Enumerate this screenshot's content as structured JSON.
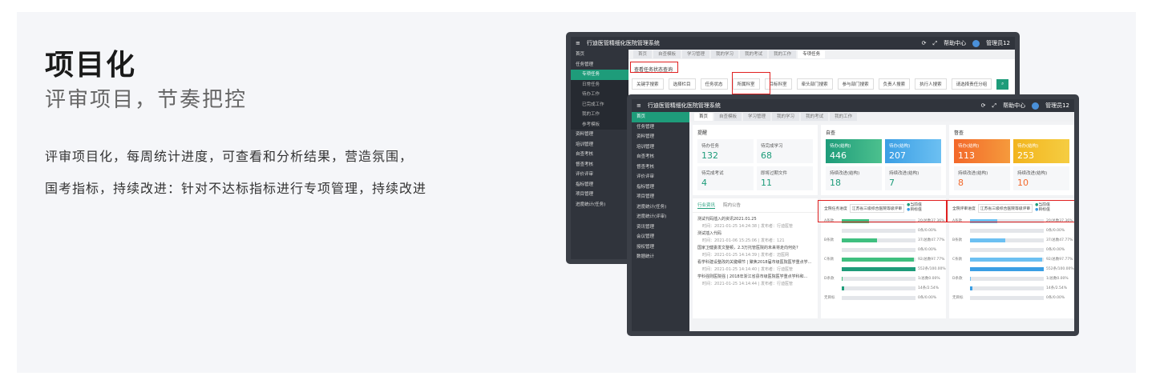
{
  "heading": {
    "title": "项目化",
    "subtitle": "评审项目，节奏把控",
    "line1": "评审项目化，每周统计进度，可查看和分析结果，营造氛围，",
    "line2": "国考指标，持续改进：针对不达标指标进行专项管理，持续改进"
  },
  "app": {
    "name": "行迪医管精细化医院管理系统",
    "help": "帮助中心",
    "user": "管理员12"
  },
  "back": {
    "tabs": [
      "首页",
      "自查模板",
      "学习管理",
      "我的学习",
      "我的考试",
      "我的工作",
      "专项任务"
    ],
    "side": [
      {
        "l": "首页",
        "t": "m"
      },
      {
        "l": "任务管理",
        "t": "m"
      },
      {
        "l": "专项任务",
        "t": "sa"
      },
      {
        "l": "日常任务",
        "t": "s"
      },
      {
        "l": "待办工作",
        "t": "s"
      },
      {
        "l": "已完成工作",
        "t": "s"
      },
      {
        "l": "我的工作",
        "t": "s"
      },
      {
        "l": "参考模板",
        "t": "s"
      },
      {
        "l": "资料管理",
        "t": "m"
      },
      {
        "l": "培训管理",
        "t": "m"
      },
      {
        "l": "自查考核",
        "t": "m"
      },
      {
        "l": "督查考核",
        "t": "m"
      },
      {
        "l": "评价评审",
        "t": "m"
      },
      {
        "l": "指标管理",
        "t": "m"
      },
      {
        "l": "项目管理",
        "t": "m"
      },
      {
        "l": "进度统计(任务)",
        "t": "m"
      }
    ],
    "btn": "查看任务状态查询",
    "filters": [
      "关键字搜索",
      "选择栏目",
      "任务状态",
      "所属科室",
      "目标科室",
      "牵头部门搜索",
      "参与部门搜索",
      "负责人搜索",
      "执行人搜索",
      "请选择责任分组"
    ]
  },
  "front": {
    "tabs": [
      "首页",
      "自查模板",
      "学习管理",
      "我的学习",
      "我的考试",
      "我的工作"
    ],
    "side": [
      "首页",
      "任务管理",
      "资料管理",
      "培训管理",
      "自查考核",
      "督查考核",
      "评价评审",
      "指标管理",
      "项目管理",
      "进度统计(任务)",
      "进度统计(评审)",
      "资讯管理",
      "会议管理",
      "授权管理",
      "数据统计"
    ],
    "remind": {
      "title": "提醒",
      "tiles": [
        {
          "l": "待办任务",
          "v": "132"
        },
        {
          "l": "待完成学习",
          "v": "68"
        },
        {
          "l": "待完成考试",
          "v": "4"
        },
        {
          "l": "即将过期文件",
          "v": "11"
        }
      ]
    },
    "self": {
      "title": "自查",
      "tiles": [
        {
          "l": "待办(结构)",
          "v": "446"
        },
        {
          "l": "待办(结构)",
          "v": "207"
        },
        {
          "l": "持续改进(结构)",
          "v": "18"
        },
        {
          "l": "持续改进(结构)",
          "v": "7"
        }
      ]
    },
    "sup": {
      "title": "督查",
      "tiles": [
        {
          "l": "待办(结构)",
          "v": "113"
        },
        {
          "l": "待办(结构)",
          "v": "253"
        },
        {
          "l": "持续改进(结构)",
          "v": "8"
        },
        {
          "l": "持续改进(结构)",
          "v": "10"
        }
      ]
    },
    "newsTabs": [
      "行业资讯",
      "院内公告"
    ],
    "news": [
      {
        "t": "测试代码插入的资讯2021.01.25",
        "m": "时间：2021-01-25 14:24:38 | 发布者：行迪医管"
      },
      {
        "t": "测试插入代码",
        "m": "时间：2021-01-06 15:25:06 | 发布者：121"
      },
      {
        "t": "国家卫健委发文整顿，2.3万托管医院的未来将走向何处?",
        "m": "时间：2021-01-25 14:14:39 | 发布者：迈医网"
      },
      {
        "t": "看学科建设整改的关键细节 | 聚焦2018届市级医院医学重点学...",
        "m": "时间：2021-01-25 14:14:40 | 发布者：行迪医管"
      },
      {
        "t": "学科强则医院强 | 2018年浙江省县市级医院医学重点学科和...",
        "m": "时间：2021-01-25 14:14:44 | 发布者：行迪医管"
      }
    ],
    "prog1": {
      "label": "全院任务进度",
      "sel": "江苏省三级综合医院等级评审",
      "leg": [
        "当前值",
        "目标值"
      ]
    },
    "prog2": {
      "label": "全院评审进度",
      "sel": "江苏省三级综合医院等级评审",
      "leg": [
        "当前值",
        "目标值"
      ]
    },
    "rows1": [
      {
        "g": "A条款",
        "v": "20/总数37.36%",
        "p": 0.37
      },
      {
        "g": "",
        "v": "0条/0.00%",
        "p": 0
      },
      {
        "g": "B条款",
        "v": "37/总数47.77%",
        "p": 0.48
      },
      {
        "g": "",
        "v": "0条/0.00%",
        "p": 0
      },
      {
        "g": "C条款",
        "v": "92/总数97.77%",
        "p": 0.98
      },
      {
        "g": "",
        "v": "552条/100.00%",
        "p": 1
      },
      {
        "g": "D条款",
        "v": "1/总数0.00%",
        "p": 0.01
      },
      {
        "g": "",
        "v": "14条/2.54%",
        "p": 0.03
      },
      {
        "g": "无目标",
        "v": "0条/0.00%",
        "p": 0
      }
    ],
    "rows2": [
      {
        "g": "A条款",
        "v": "20/总数37.36%",
        "p": 0.37
      },
      {
        "g": "",
        "v": "0条/0.00%",
        "p": 0
      },
      {
        "g": "B条款",
        "v": "37/总数47.77%",
        "p": 0.48
      },
      {
        "g": "",
        "v": "0条/0.00%",
        "p": 0
      },
      {
        "g": "C条款",
        "v": "92/总数97.77%",
        "p": 0.98
      },
      {
        "g": "",
        "v": "552条/100.00%",
        "p": 1
      },
      {
        "g": "D条款",
        "v": "1/总数0.00%",
        "p": 0.01
      },
      {
        "g": "",
        "v": "14条/2.54%",
        "p": 0.03
      },
      {
        "g": "无目标",
        "v": "0条/0.00%",
        "p": 0
      }
    ]
  },
  "colors": {
    "green": "#1e9c7a",
    "teal": "#27a98a",
    "blue": "#3a9ee4",
    "orange": "#f3682a",
    "yellow": "#f2b41d",
    "sidebar": "#30343c"
  }
}
